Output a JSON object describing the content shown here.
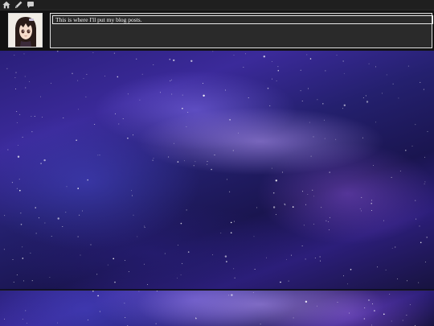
{
  "nav": {
    "icons": [
      "home-icon",
      "pencil-icon",
      "chat-icon"
    ]
  },
  "header": {
    "post_text": "This is where I'll put my blog posts."
  },
  "colors": {
    "topbar": "#1f1f1f",
    "header_bg": "#121212",
    "post_box_bg": "#2a2a2a",
    "galaxy_base": "#2a1f7a"
  }
}
